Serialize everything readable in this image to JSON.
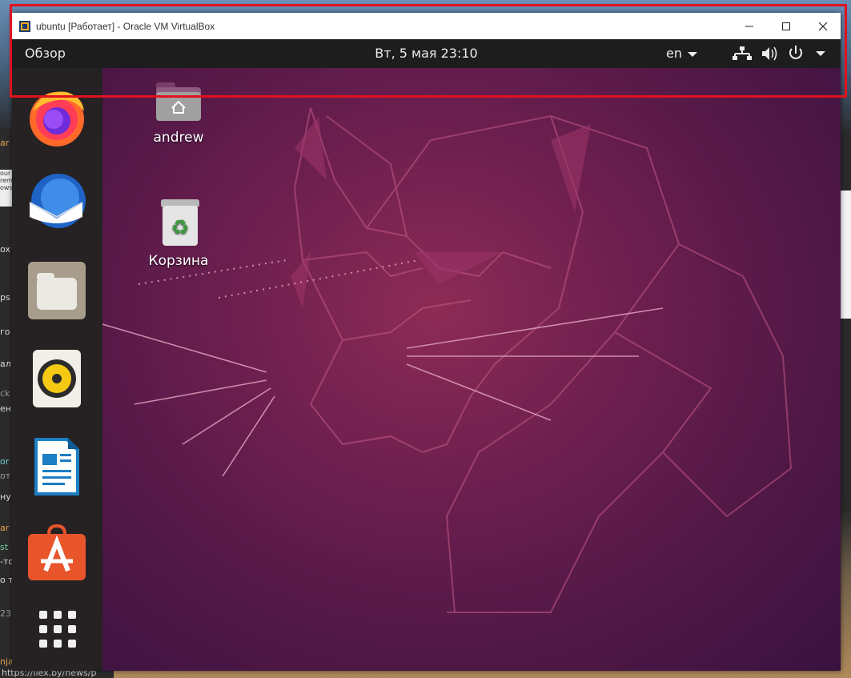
{
  "window": {
    "title": "ubuntu [Работает] - Oracle VM VirtualBox"
  },
  "topbar": {
    "activities": "Обзор",
    "clock": "Вт, 5 мая  23:10",
    "language": "en"
  },
  "dock": {
    "items": [
      "firefox",
      "thunderbird",
      "files",
      "rhythmbox",
      "libreoffice-writer",
      "ubuntu-software",
      "show-applications"
    ]
  },
  "desktop": {
    "icons": [
      {
        "label": "andrew",
        "icon": "home-folder-icon"
      },
      {
        "label": "Корзина",
        "icon": "trash-icon"
      }
    ]
  },
  "host": {
    "bottom_link": "https://ilex.by/news/p"
  },
  "colors": {
    "highlight": "#e0121f",
    "topbar": "#1d1d1d",
    "dock": "#262122",
    "wallpaper": "#6d1f4f"
  }
}
